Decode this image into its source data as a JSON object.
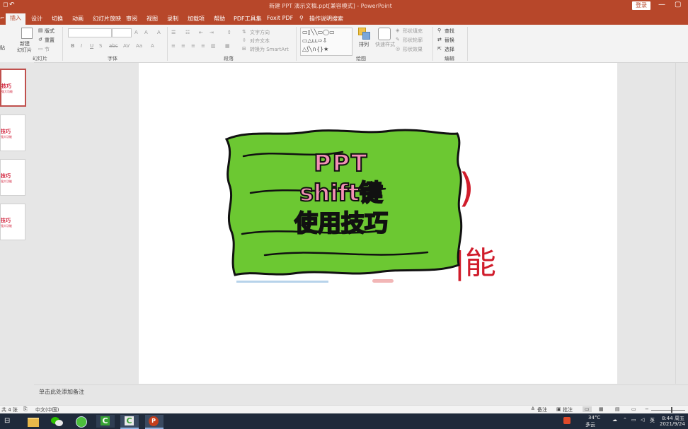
{
  "window": {
    "title": "新建 PPT 演示文稿.ppt[兼容模式] - PowerPoint",
    "login": "登录"
  },
  "tabs": [
    "插入",
    "设计",
    "切换",
    "动画",
    "幻灯片放映",
    "审阅",
    "视图",
    "录制",
    "加载项",
    "帮助",
    "PDF工具集",
    "Foxit PDF"
  ],
  "active_tab": "插入",
  "tell_me": "操作说明搜索",
  "ribbon": {
    "slides": {
      "new_slide": "新建",
      "new_slide2": "幻灯片",
      "layout": "版式",
      "reset": "重置",
      "section": "节",
      "label": "幻灯片"
    },
    "font": {
      "label": "字体"
    },
    "paragraph": {
      "text_direction": "文字方向",
      "align_text": "对齐文本",
      "smartart": "转换为 SmartArt",
      "label": "段落"
    },
    "drawing": {
      "arrange": "排列",
      "quick_styles": "快速样式",
      "shape_fill": "形状填充",
      "shape_outline": "形状轮廓",
      "shape_effects": "形状效果",
      "label": "绘图"
    },
    "editing": {
      "find": "查找",
      "replace": "替换",
      "select": "选择",
      "label": "编辑"
    }
  },
  "thumbnails": [
    {
      "line1": "技巧",
      "line2": "强大功能"
    },
    {
      "line1": "技巧",
      "line2": "强大功能"
    },
    {
      "line1": "技巧",
      "line2": "强大功能"
    },
    {
      "line1": "技巧",
      "line2": "强大功能"
    }
  ],
  "slide": {
    "sticker_lines": [
      "PPT",
      "shift键",
      "使用技巧"
    ],
    "partial_text": "能",
    "colors": {
      "sticker_green": "#6cc832",
      "sticker_text": "#f28fb4",
      "red_text": "#d01c2b"
    }
  },
  "notes_placeholder": "单击此处添加备注",
  "status": {
    "slide_count": "共 4 张",
    "language": "中文(中国)",
    "notes": "备注",
    "comments": "批注"
  },
  "taskbar": {
    "weather_temp": "34°C",
    "weather_desc": "多云",
    "time": "8:44 周五",
    "date": "2021/9/24"
  }
}
